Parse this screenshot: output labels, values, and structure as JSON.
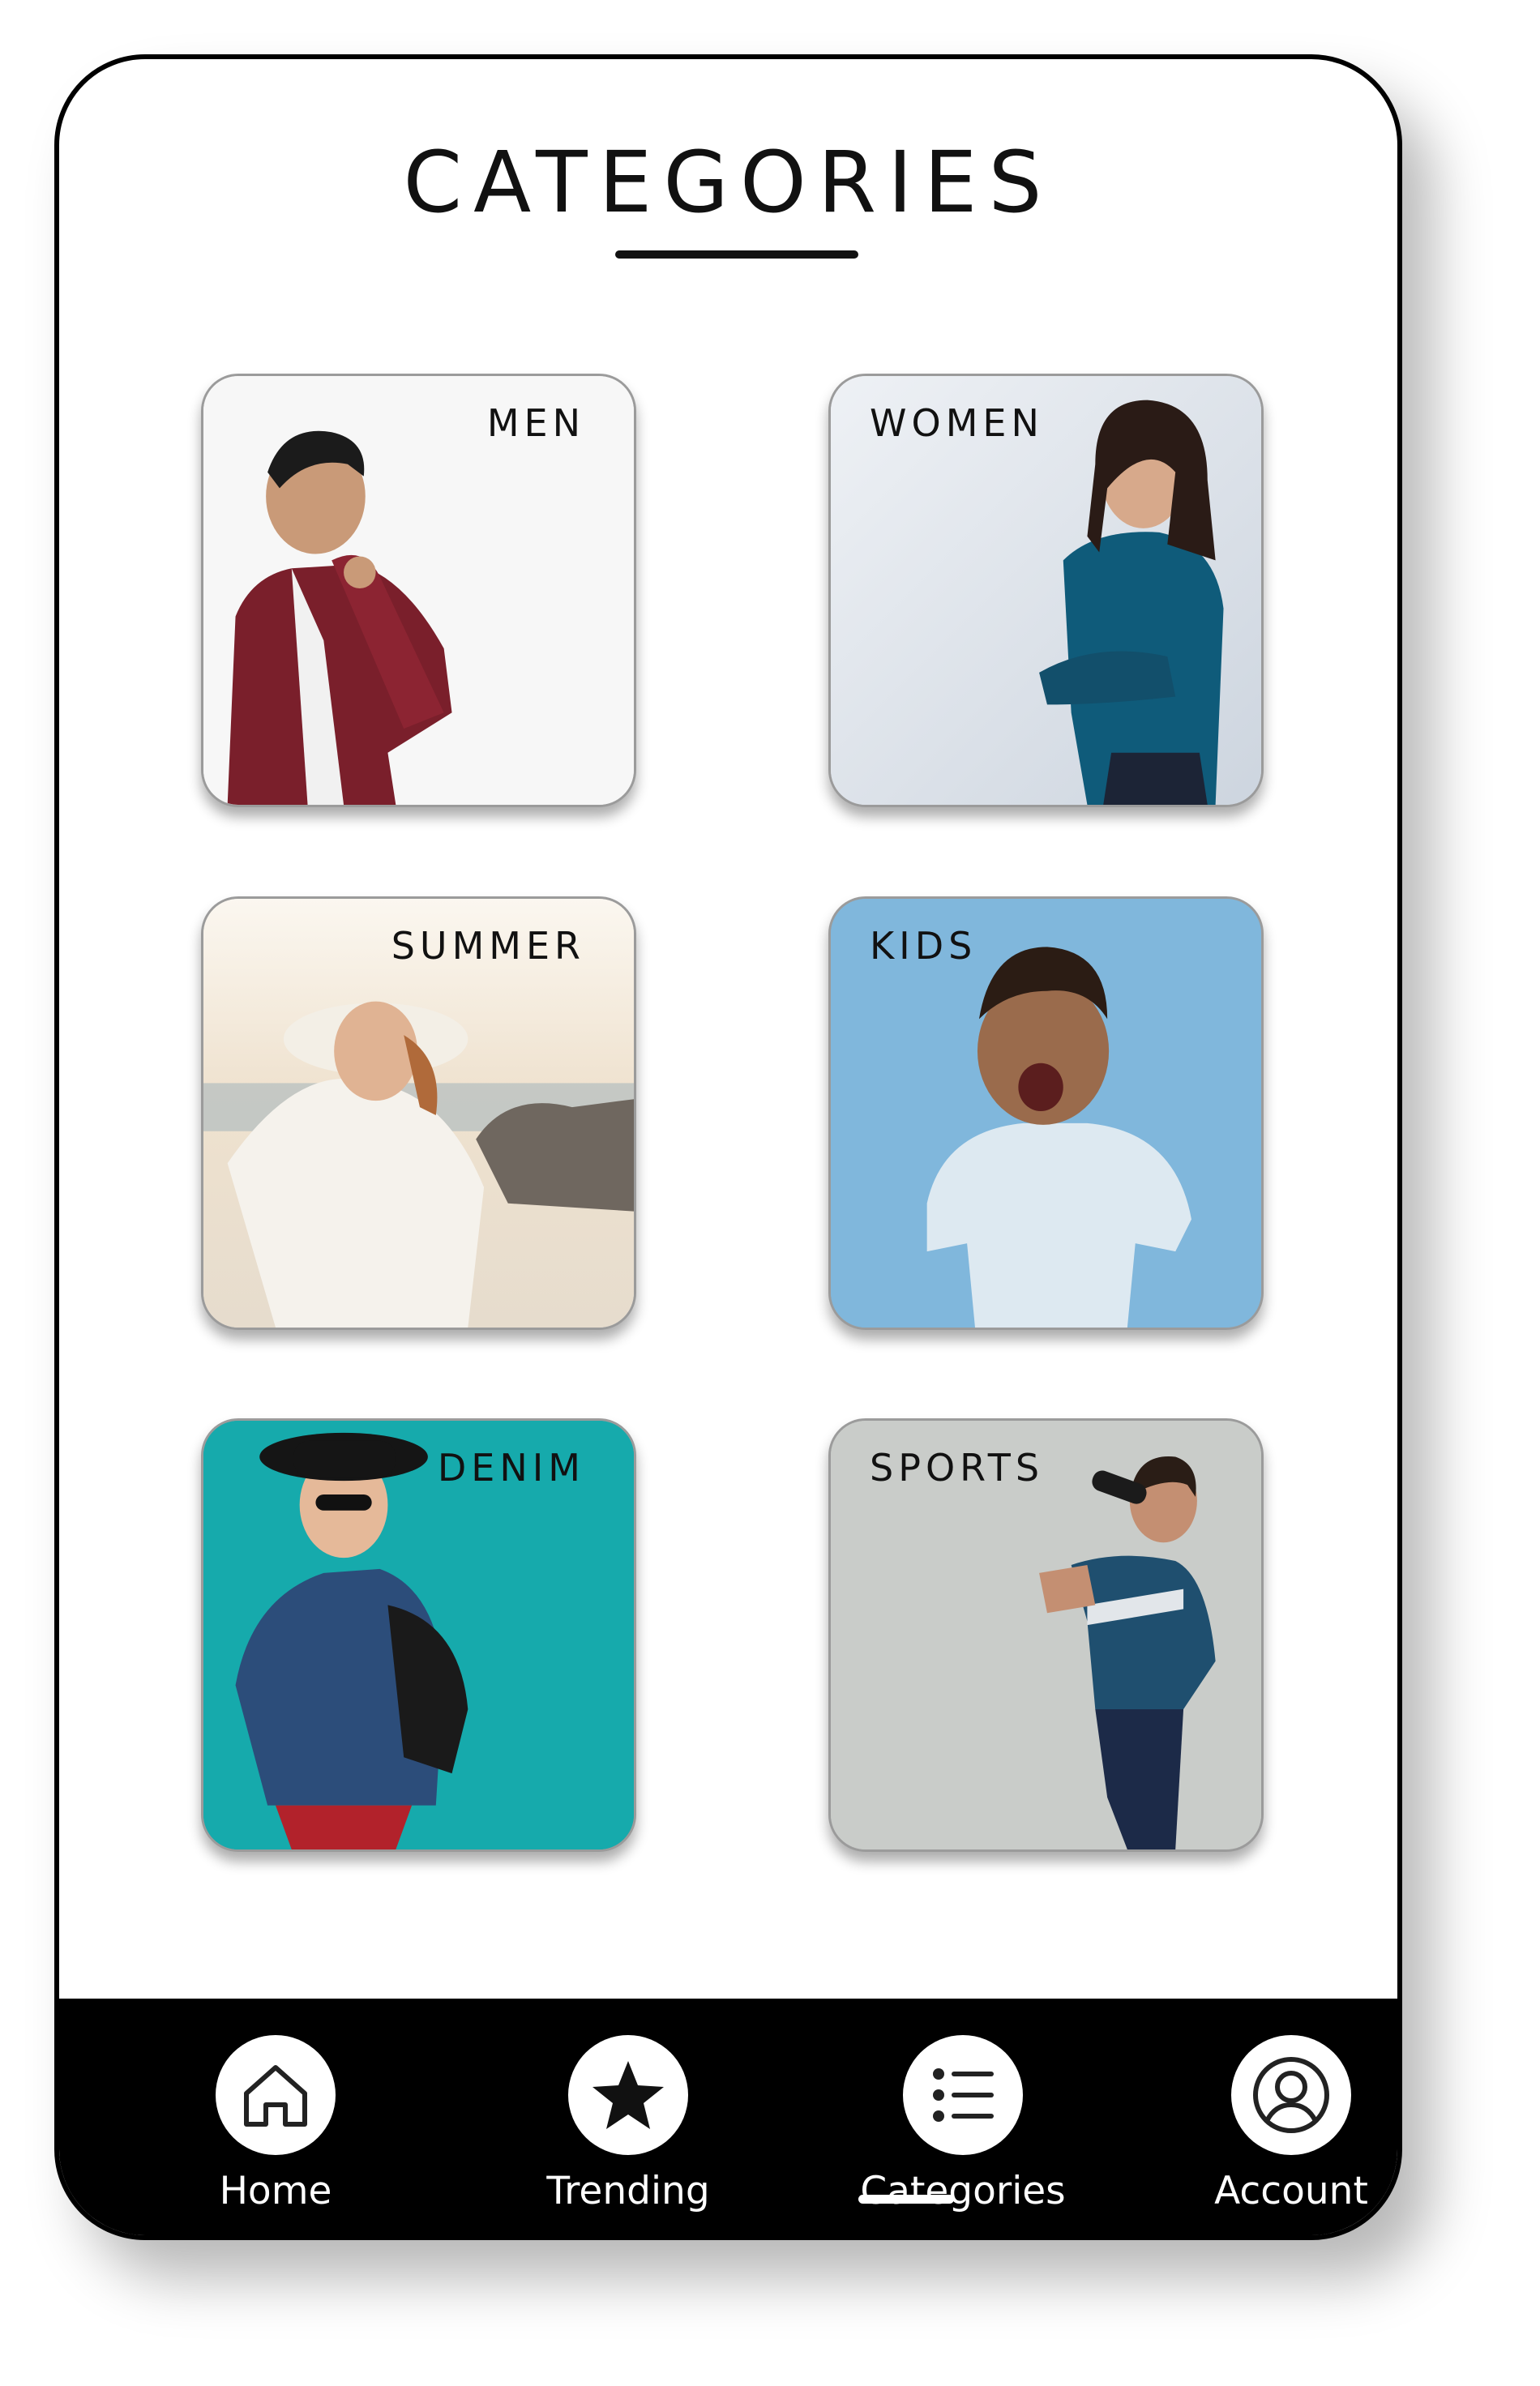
{
  "header": {
    "title": "CATEGORIES"
  },
  "categories": [
    {
      "label": "MEN",
      "bg": "#f6f6f6"
    },
    {
      "label": "WOMEN",
      "bg": "#dde3ea"
    },
    {
      "label": "SUMMER",
      "bg": "#e9e4dc"
    },
    {
      "label": "KIDS",
      "bg": "#7fb6dc"
    },
    {
      "label": "DENIM",
      "bg": "#15a9ab"
    },
    {
      "label": "SPORTS",
      "bg": "#c7cac7"
    }
  ],
  "nav": {
    "items": [
      {
        "label": "Home",
        "icon": "home-icon"
      },
      {
        "label": "Trending",
        "icon": "star-icon"
      },
      {
        "label": "Categories",
        "icon": "list-icon",
        "active": true
      },
      {
        "label": "Account",
        "icon": "user-icon"
      }
    ]
  }
}
